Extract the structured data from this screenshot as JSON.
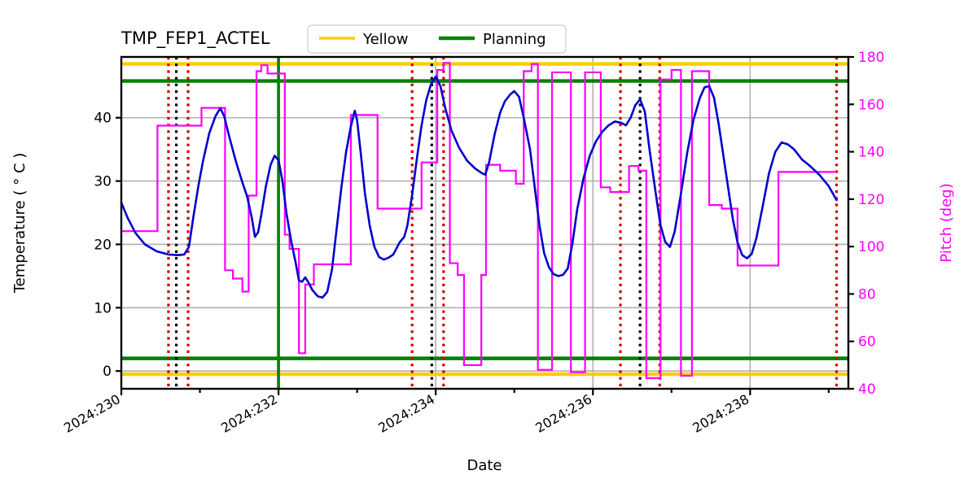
{
  "chart_data": {
    "type": "line",
    "title": "TMP_FEP1_ACTEL",
    "xlabel": "Date",
    "ylabel": "Temperature ( ° C )",
    "ylabel_right": "Pitch (deg)",
    "grid": true,
    "legend_position": "upper center",
    "legend": [
      {
        "label": "Yellow",
        "color": "#ffcc00"
      },
      {
        "label": "Planning",
        "color": "#008000"
      }
    ],
    "xlim": [
      230.0,
      239.25
    ],
    "xticks": [
      230,
      231,
      232,
      233,
      234,
      235,
      236,
      237,
      238,
      239
    ],
    "xtick_labels": [
      "2024:230",
      "",
      "2024:232",
      "",
      "2024:234",
      "",
      "2024:236",
      "",
      "2024:238",
      ""
    ],
    "ylim": [
      -2.8,
      49.6
    ],
    "yticks": [
      0,
      10,
      20,
      30,
      40
    ],
    "ytick_labels": [
      "0",
      "10",
      "20",
      "30",
      "40"
    ],
    "ylim_right": [
      40,
      180
    ],
    "yticks_right": [
      40,
      60,
      80,
      100,
      120,
      140,
      160,
      180
    ],
    "ytick_labels_right": [
      "40",
      "60",
      "80",
      "100",
      "120",
      "140",
      "160",
      "180"
    ],
    "series": [
      {
        "name": "Temperature",
        "color": "#0000cd",
        "axis": "left",
        "points": [
          [
            230.0,
            26.6
          ],
          [
            230.08,
            24.2
          ],
          [
            230.18,
            21.8
          ],
          [
            230.3,
            20.0
          ],
          [
            230.45,
            18.9
          ],
          [
            230.6,
            18.4
          ],
          [
            230.72,
            18.3
          ],
          [
            230.8,
            18.4
          ],
          [
            230.86,
            19.6
          ],
          [
            230.92,
            24.6
          ],
          [
            230.98,
            29.2
          ],
          [
            231.04,
            33.2
          ],
          [
            231.12,
            37.6
          ],
          [
            231.2,
            40.3
          ],
          [
            231.26,
            41.5
          ],
          [
            231.31,
            40.2
          ],
          [
            231.38,
            36.7
          ],
          [
            231.46,
            33.0
          ],
          [
            231.54,
            29.8
          ],
          [
            231.6,
            27.6
          ],
          [
            231.66,
            24.2
          ],
          [
            231.7,
            21.2
          ],
          [
            231.74,
            21.9
          ],
          [
            231.78,
            24.6
          ],
          [
            231.84,
            29.2
          ],
          [
            231.9,
            32.6
          ],
          [
            231.95,
            34.0
          ],
          [
            232.0,
            33.3
          ],
          [
            232.05,
            30.0
          ],
          [
            232.1,
            25.0
          ],
          [
            232.16,
            20.6
          ],
          [
            232.22,
            17.0
          ],
          [
            232.26,
            14.3
          ],
          [
            232.3,
            14.1
          ],
          [
            232.34,
            14.8
          ],
          [
            232.38,
            14.0
          ],
          [
            232.43,
            12.8
          ],
          [
            232.5,
            11.8
          ],
          [
            232.56,
            11.6
          ],
          [
            232.62,
            12.5
          ],
          [
            232.68,
            16.0
          ],
          [
            232.74,
            22.5
          ],
          [
            232.8,
            29.0
          ],
          [
            232.86,
            34.6
          ],
          [
            232.92,
            38.6
          ],
          [
            232.97,
            41.1
          ],
          [
            233.0,
            39.6
          ],
          [
            233.05,
            34.0
          ],
          [
            233.1,
            28.0
          ],
          [
            233.16,
            23.0
          ],
          [
            233.22,
            19.6
          ],
          [
            233.28,
            18.0
          ],
          [
            233.34,
            17.6
          ],
          [
            233.4,
            17.9
          ],
          [
            233.46,
            18.4
          ],
          [
            233.54,
            20.3
          ],
          [
            233.6,
            21.2
          ],
          [
            233.64,
            23.0
          ],
          [
            233.7,
            27.8
          ],
          [
            233.76,
            33.5
          ],
          [
            233.82,
            38.8
          ],
          [
            233.88,
            42.8
          ],
          [
            233.94,
            45.3
          ],
          [
            234.0,
            46.5
          ],
          [
            234.06,
            45.0
          ],
          [
            234.12,
            41.6
          ],
          [
            234.2,
            38.0
          ],
          [
            234.3,
            35.2
          ],
          [
            234.4,
            33.2
          ],
          [
            234.5,
            32.0
          ],
          [
            234.58,
            31.3
          ],
          [
            234.63,
            31.0
          ],
          [
            234.68,
            33.0
          ],
          [
            234.75,
            37.4
          ],
          [
            234.82,
            40.8
          ],
          [
            234.88,
            42.6
          ],
          [
            234.95,
            43.7
          ],
          [
            235.0,
            44.2
          ],
          [
            235.06,
            43.3
          ],
          [
            235.12,
            40.0
          ],
          [
            235.2,
            35.0
          ],
          [
            235.26,
            29.0
          ],
          [
            235.32,
            23.0
          ],
          [
            235.38,
            18.6
          ],
          [
            235.44,
            16.4
          ],
          [
            235.5,
            15.3
          ],
          [
            235.56,
            15.0
          ],
          [
            235.62,
            15.2
          ],
          [
            235.68,
            16.2
          ],
          [
            235.74,
            20.2
          ],
          [
            235.8,
            25.5
          ],
          [
            235.88,
            30.4
          ],
          [
            235.96,
            34.0
          ],
          [
            236.04,
            36.3
          ],
          [
            236.12,
            37.8
          ],
          [
            236.2,
            38.8
          ],
          [
            236.28,
            39.4
          ],
          [
            236.36,
            39.2
          ],
          [
            236.42,
            38.8
          ],
          [
            236.48,
            40.0
          ],
          [
            236.54,
            42.0
          ],
          [
            236.6,
            42.9
          ],
          [
            236.66,
            41.0
          ],
          [
            236.72,
            35.0
          ],
          [
            236.8,
            28.0
          ],
          [
            236.86,
            23.0
          ],
          [
            236.92,
            20.4
          ],
          [
            236.98,
            19.6
          ],
          [
            237.04,
            22.0
          ],
          [
            237.12,
            28.0
          ],
          [
            237.2,
            34.5
          ],
          [
            237.28,
            39.7
          ],
          [
            237.36,
            43.1
          ],
          [
            237.42,
            44.8
          ],
          [
            237.48,
            45.0
          ],
          [
            237.54,
            43.2
          ],
          [
            237.6,
            39.0
          ],
          [
            237.66,
            34.0
          ],
          [
            237.72,
            29.0
          ],
          [
            237.78,
            24.0
          ],
          [
            237.84,
            20.3
          ],
          [
            237.9,
            18.3
          ],
          [
            237.96,
            17.8
          ],
          [
            238.02,
            18.5
          ],
          [
            238.08,
            21.0
          ],
          [
            238.16,
            26.0
          ],
          [
            238.24,
            31.2
          ],
          [
            238.32,
            34.6
          ],
          [
            238.4,
            36.1
          ],
          [
            238.48,
            35.8
          ],
          [
            238.56,
            35.0
          ],
          [
            238.66,
            33.4
          ],
          [
            238.76,
            32.4
          ],
          [
            238.88,
            31.0
          ],
          [
            239.0,
            29.2
          ],
          [
            239.1,
            27.0
          ]
        ]
      },
      {
        "name": "Pitch",
        "color": "#ff00ff",
        "axis": "right",
        "style": "step",
        "points": [
          [
            230.0,
            106.5
          ],
          [
            230.46,
            106.5
          ],
          [
            230.46,
            151.0
          ],
          [
            231.02,
            151.0
          ],
          [
            231.02,
            158.5
          ],
          [
            231.32,
            158.5
          ],
          [
            231.32,
            90.0
          ],
          [
            231.42,
            90.0
          ],
          [
            231.42,
            86.5
          ],
          [
            231.54,
            86.5
          ],
          [
            231.54,
            81.0
          ],
          [
            231.62,
            81.0
          ],
          [
            231.62,
            121.5
          ],
          [
            231.72,
            121.5
          ],
          [
            231.72,
            174.0
          ],
          [
            231.78,
            174.0
          ],
          [
            231.78,
            176.5
          ],
          [
            231.86,
            176.5
          ],
          [
            231.86,
            173.0
          ],
          [
            232.08,
            173.0
          ],
          [
            232.08,
            105.0
          ],
          [
            232.14,
            105.0
          ],
          [
            232.14,
            99.0
          ],
          [
            232.26,
            99.0
          ],
          [
            232.26,
            55.0
          ],
          [
            232.34,
            55.0
          ],
          [
            232.34,
            84.0
          ],
          [
            232.45,
            84.0
          ],
          [
            232.45,
            92.5
          ],
          [
            232.92,
            92.5
          ],
          [
            232.92,
            155.5
          ],
          [
            233.26,
            155.5
          ],
          [
            233.26,
            116.0
          ],
          [
            233.82,
            116.0
          ],
          [
            233.82,
            135.5
          ],
          [
            234.02,
            135.5
          ],
          [
            234.02,
            174.5
          ],
          [
            234.1,
            174.5
          ],
          [
            234.1,
            177.5
          ],
          [
            234.18,
            177.5
          ],
          [
            234.18,
            93.0
          ],
          [
            234.28,
            93.0
          ],
          [
            234.28,
            88.0
          ],
          [
            234.36,
            88.0
          ],
          [
            234.36,
            50.0
          ],
          [
            234.58,
            50.0
          ],
          [
            234.58,
            88.0
          ],
          [
            234.64,
            88.0
          ],
          [
            234.64,
            134.5
          ],
          [
            234.82,
            134.5
          ],
          [
            234.82,
            132.0
          ],
          [
            235.02,
            132.0
          ],
          [
            235.02,
            126.5
          ],
          [
            235.12,
            126.5
          ],
          [
            235.12,
            174.0
          ],
          [
            235.22,
            174.0
          ],
          [
            235.22,
            177.0
          ],
          [
            235.3,
            177.0
          ],
          [
            235.3,
            48.0
          ],
          [
            235.48,
            48.0
          ],
          [
            235.48,
            173.5
          ],
          [
            235.72,
            173.5
          ],
          [
            235.72,
            47.0
          ],
          [
            235.9,
            47.0
          ],
          [
            235.9,
            173.5
          ],
          [
            236.1,
            173.5
          ],
          [
            236.1,
            125.0
          ],
          [
            236.22,
            125.0
          ],
          [
            236.22,
            123.0
          ],
          [
            236.46,
            123.0
          ],
          [
            236.46,
            134.0
          ],
          [
            236.58,
            134.0
          ],
          [
            236.58,
            132.0
          ],
          [
            236.68,
            132.0
          ],
          [
            236.68,
            44.5
          ],
          [
            236.86,
            44.5
          ],
          [
            236.86,
            170.5
          ],
          [
            237.0,
            170.5
          ],
          [
            237.0,
            174.5
          ],
          [
            237.12,
            174.5
          ],
          [
            237.12,
            45.5
          ],
          [
            237.26,
            45.5
          ],
          [
            237.26,
            174.0
          ],
          [
            237.48,
            174.0
          ],
          [
            237.48,
            117.5
          ],
          [
            237.64,
            117.5
          ],
          [
            237.64,
            116.0
          ],
          [
            237.84,
            116.0
          ],
          [
            237.84,
            92.0
          ],
          [
            238.36,
            92.0
          ],
          [
            238.36,
            131.5
          ],
          [
            239.1,
            131.5
          ]
        ]
      }
    ],
    "limit_lines": [
      {
        "name": "yellow-high",
        "value": 48.5,
        "color": "#ffcc00",
        "orientation": "horizontal"
      },
      {
        "name": "yellow-low",
        "value": -0.5,
        "color": "#ffcc00",
        "orientation": "horizontal"
      },
      {
        "name": "planning-high",
        "value": 45.8,
        "color": "#008000",
        "orientation": "horizontal"
      },
      {
        "name": "planning-low",
        "value": 2.0,
        "color": "#008000",
        "orientation": "horizontal"
      }
    ],
    "event_lines": [
      {
        "x": 230.6,
        "color": "#cc0000",
        "style": "dotted"
      },
      {
        "x": 230.7,
        "color": "#000000",
        "style": "dotted"
      },
      {
        "x": 230.85,
        "color": "#cc0000",
        "style": "dotted"
      },
      {
        "x": 232.0,
        "color": "#008000",
        "style": "solid"
      },
      {
        "x": 233.7,
        "color": "#cc0000",
        "style": "dotted"
      },
      {
        "x": 233.95,
        "color": "#000000",
        "style": "dotted"
      },
      {
        "x": 234.1,
        "color": "#cc0000",
        "style": "dotted"
      },
      {
        "x": 236.35,
        "color": "#cc0000",
        "style": "dotted"
      },
      {
        "x": 236.6,
        "color": "#000000",
        "style": "dotted"
      },
      {
        "x": 236.85,
        "color": "#cc0000",
        "style": "dotted"
      },
      {
        "x": 239.1,
        "color": "#cc0000",
        "style": "dotted"
      }
    ]
  }
}
